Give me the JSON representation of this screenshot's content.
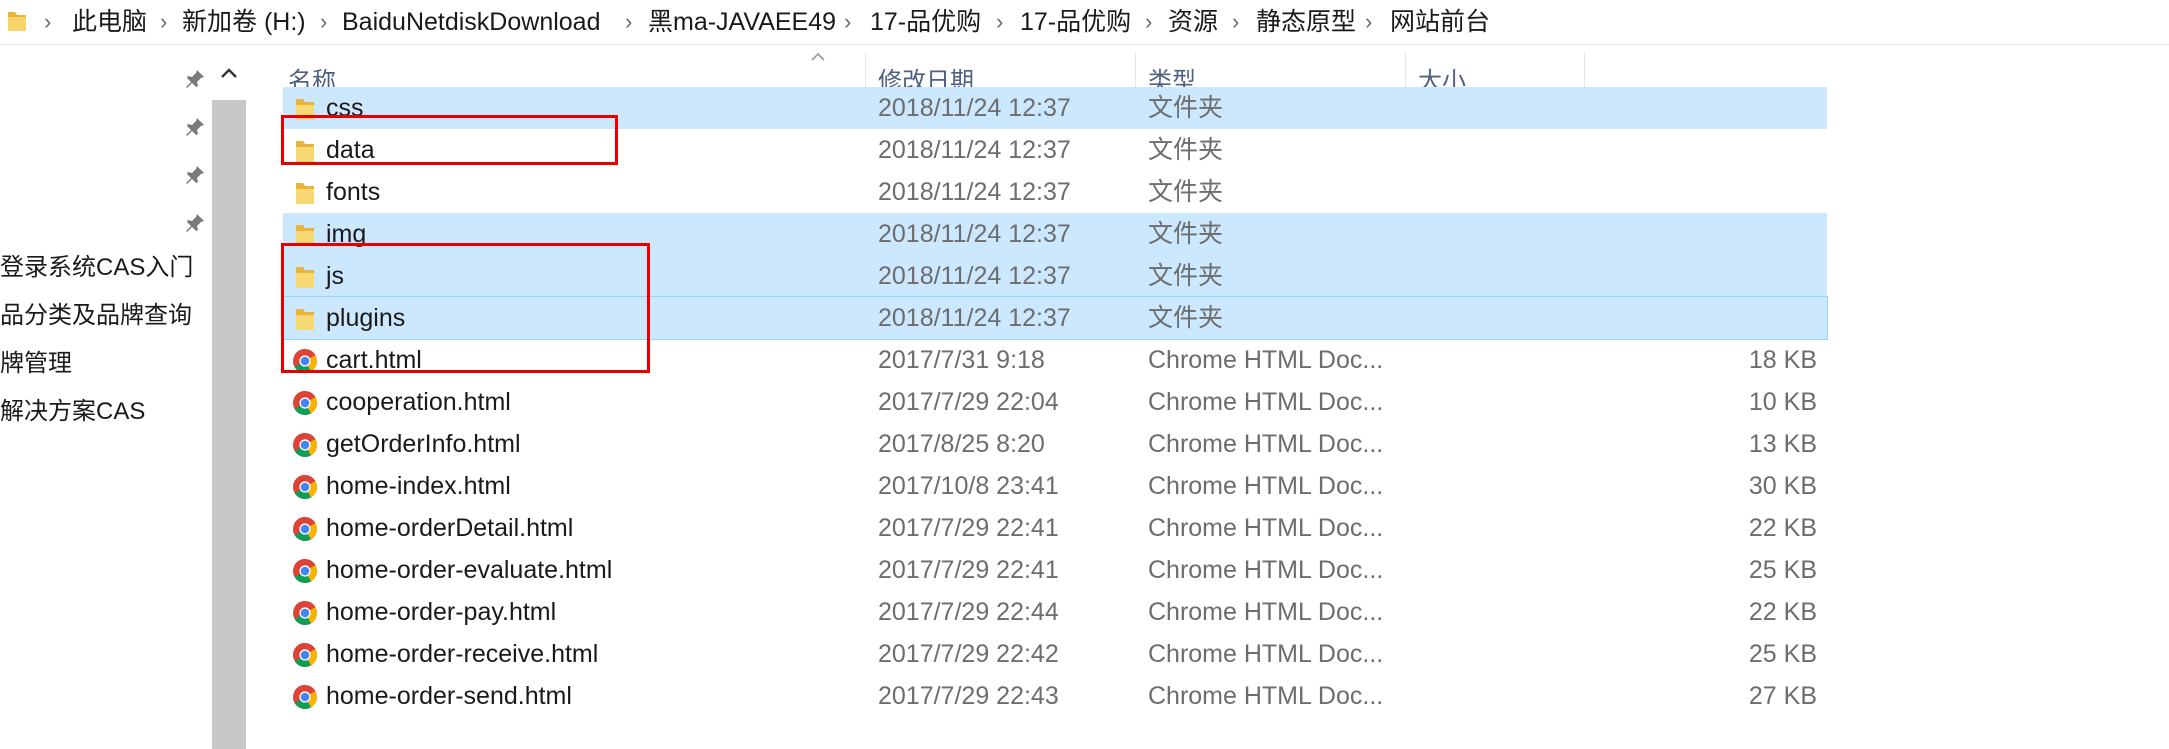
{
  "breadcrumb": {
    "items": [
      "此电脑",
      "新加卷 (H:)",
      "BaiduNetdiskDownload",
      "黑ma-JAVAEE49",
      "17-品优购",
      "17-品优购",
      "资源",
      "静态原型",
      "网站前台"
    ],
    "separator": "›"
  },
  "navpane": {
    "items": [
      "登录系统CAS入门",
      "品分类及品牌查询",
      "牌管理",
      "解决方案CAS"
    ]
  },
  "columns": {
    "name": "名称",
    "date": "修改日期",
    "type": "类型",
    "size": "大小"
  },
  "files": [
    {
      "name": "css",
      "date": "2018/11/24 12:37",
      "type": "文件夹",
      "size": "",
      "icon": "folder-icon",
      "selected": true
    },
    {
      "name": "data",
      "date": "2018/11/24 12:37",
      "type": "文件夹",
      "size": "",
      "icon": "folder-icon",
      "selected": false
    },
    {
      "name": "fonts",
      "date": "2018/11/24 12:37",
      "type": "文件夹",
      "size": "",
      "icon": "folder-icon",
      "selected": false
    },
    {
      "name": "img",
      "date": "2018/11/24 12:37",
      "type": "文件夹",
      "size": "",
      "icon": "folder-icon",
      "selected": true
    },
    {
      "name": "js",
      "date": "2018/11/24 12:37",
      "type": "文件夹",
      "size": "",
      "icon": "folder-icon",
      "selected": true
    },
    {
      "name": "plugins",
      "date": "2018/11/24 12:37",
      "type": "文件夹",
      "size": "",
      "icon": "folder-icon",
      "selected": true
    },
    {
      "name": "cart.html",
      "date": "2017/7/31 9:18",
      "type": "Chrome HTML Doc...",
      "size": "18 KB",
      "icon": "chrome-icon",
      "selected": false
    },
    {
      "name": "cooperation.html",
      "date": "2017/7/29 22:04",
      "type": "Chrome HTML Doc...",
      "size": "10 KB",
      "icon": "chrome-icon",
      "selected": false
    },
    {
      "name": "getOrderInfo.html",
      "date": "2017/8/25 8:20",
      "type": "Chrome HTML Doc...",
      "size": "13 KB",
      "icon": "chrome-icon",
      "selected": false
    },
    {
      "name": "home-index.html",
      "date": "2017/10/8 23:41",
      "type": "Chrome HTML Doc...",
      "size": "30 KB",
      "icon": "chrome-icon",
      "selected": false
    },
    {
      "name": "home-orderDetail.html",
      "date": "2017/7/29 22:41",
      "type": "Chrome HTML Doc...",
      "size": "22 KB",
      "icon": "chrome-icon",
      "selected": false
    },
    {
      "name": "home-order-evaluate.html",
      "date": "2017/7/29 22:41",
      "type": "Chrome HTML Doc...",
      "size": "25 KB",
      "icon": "chrome-icon",
      "selected": false
    },
    {
      "name": "home-order-pay.html",
      "date": "2017/7/29 22:44",
      "type": "Chrome HTML Doc...",
      "size": "22 KB",
      "icon": "chrome-icon",
      "selected": false
    },
    {
      "name": "home-order-receive.html",
      "date": "2017/7/29 22:42",
      "type": "Chrome HTML Doc...",
      "size": "25 KB",
      "icon": "chrome-icon",
      "selected": false
    },
    {
      "name": "home-order-send.html",
      "date": "2017/7/29 22:43",
      "type": "Chrome HTML Doc...",
      "size": "27 KB",
      "icon": "chrome-icon",
      "selected": false
    }
  ],
  "colors": {
    "selection": "#cce8ff",
    "header_text": "#4d6082",
    "annotation": "#e60000"
  }
}
